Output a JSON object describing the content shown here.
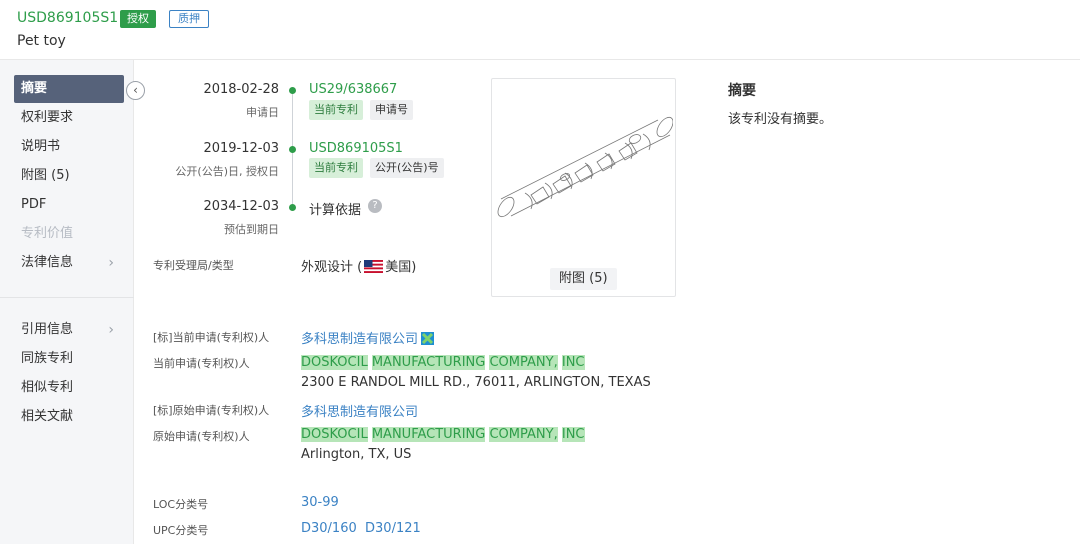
{
  "header": {
    "patent_number": "USD869105S1",
    "badge_status": "授权",
    "badge_pledge": "质押",
    "title": "Pet toy"
  },
  "sidebar": {
    "collapse_icon": "chevron-left-icon",
    "items": [
      {
        "label": "摘要"
      },
      {
        "label": "权利要求"
      },
      {
        "label": "说明书"
      },
      {
        "label": "附图 (5)"
      },
      {
        "label": "PDF"
      },
      {
        "label": "专利价值"
      },
      {
        "label": "法律信息"
      },
      {
        "label": "引用信息"
      },
      {
        "label": "同族专利"
      },
      {
        "label": "相似专利"
      },
      {
        "label": "相关文献"
      }
    ]
  },
  "timeline": {
    "events": [
      {
        "date": "2018-02-28",
        "sub": "申请日",
        "link": "US29/638667",
        "tags": [
          "当前专利",
          "申请号"
        ]
      },
      {
        "date": "2019-12-03",
        "sub": "公开(公告)日, 授权日",
        "link": "USD869105S1",
        "tags": [
          "当前专利",
          "公开(公告)号"
        ]
      },
      {
        "date": "2034-12-03",
        "sub": "预估到期日",
        "text": "计算依据"
      }
    ]
  },
  "office": {
    "label": "专利受理局/类型",
    "value_prefix": "外观设计 (",
    "country": "美国",
    "value_suffix": ")",
    "flag_colors": {
      "stripe_red": "#c8102e",
      "canton_blue": "#1f3a7a"
    }
  },
  "drawing": {
    "button_label": "附图 (5)"
  },
  "abstract": {
    "title": "摘要",
    "text": "该专利没有摘要。"
  },
  "applicants": {
    "std_current_label": "[标]当前申请(专利权)人",
    "std_current_value": "多科思制造有限公司",
    "current_label": "当前申请(专利权)人",
    "current_name_parts": [
      "DOSKOCIL",
      "MANUFACTURING",
      "COMPANY,",
      "INC"
    ],
    "current_address": "2300 E RANDOL MILL RD., 76011, ARLINGTON, TEXAS",
    "std_original_label": "[标]原始申请(专利权)人",
    "std_original_value": "多科思制造有限公司",
    "original_label": "原始申请(专利权)人",
    "original_name_parts": [
      "DOSKOCIL",
      "MANUFACTURING",
      "COMPANY,",
      "INC"
    ],
    "original_address": "Arlington, TX, US"
  },
  "classification": {
    "loc_label": "LOC分类号",
    "loc_value": "30-99",
    "upc_label": "UPC分类号",
    "upc_values": [
      "D30/160",
      "D30/121"
    ]
  },
  "colors": {
    "brand_green": "#2e9d4a",
    "link_blue": "#3b82c4",
    "nav_active": "#56627a"
  }
}
